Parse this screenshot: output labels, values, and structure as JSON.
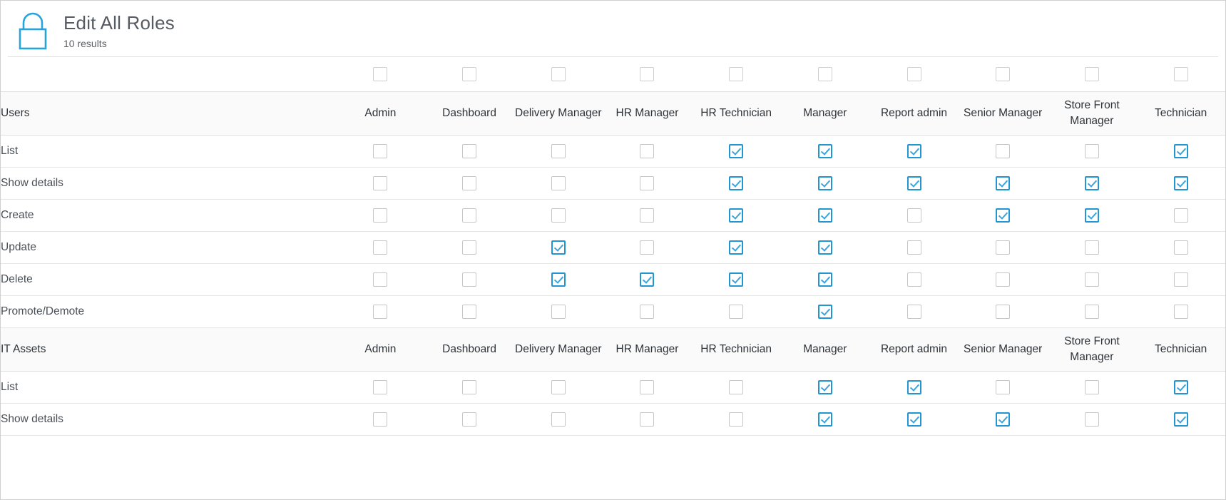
{
  "header": {
    "icon": "lock-icon",
    "title": "Edit All Roles",
    "results": "10 results"
  },
  "colors": {
    "accent": "#2196d3",
    "check": "#3ba4dd",
    "title_text": "#555b62",
    "row_text": "#4a5057",
    "group_bg": "#fafafa",
    "border": "#e6e6e6"
  },
  "roles": [
    "Admin",
    "Dashboard",
    "Delivery Manager",
    "HR Manager",
    "HR Technician",
    "Manager",
    "Report admin",
    "Senior Manager",
    "Store Front Manager",
    "Technician"
  ],
  "select_all": [
    false,
    false,
    false,
    false,
    false,
    false,
    false,
    false,
    false,
    false
  ],
  "groups": [
    {
      "name": "Users",
      "permissions": [
        {
          "name": "List",
          "values": [
            false,
            false,
            false,
            false,
            true,
            true,
            true,
            false,
            false,
            true
          ]
        },
        {
          "name": "Show details",
          "values": [
            false,
            false,
            false,
            false,
            true,
            true,
            true,
            true,
            true,
            true
          ]
        },
        {
          "name": "Create",
          "values": [
            false,
            false,
            false,
            false,
            true,
            true,
            false,
            true,
            true,
            false
          ]
        },
        {
          "name": "Update",
          "values": [
            false,
            false,
            true,
            false,
            true,
            true,
            false,
            false,
            false,
            false
          ]
        },
        {
          "name": "Delete",
          "values": [
            false,
            false,
            true,
            true,
            true,
            true,
            false,
            false,
            false,
            false
          ]
        },
        {
          "name": "Promote/Demote",
          "values": [
            false,
            false,
            false,
            false,
            false,
            true,
            false,
            false,
            false,
            false
          ]
        }
      ]
    },
    {
      "name": "IT Assets",
      "permissions": [
        {
          "name": "List",
          "values": [
            false,
            false,
            false,
            false,
            false,
            true,
            true,
            false,
            false,
            true
          ]
        },
        {
          "name": "Show details",
          "values": [
            false,
            false,
            false,
            false,
            false,
            true,
            true,
            true,
            false,
            true
          ]
        }
      ]
    }
  ]
}
